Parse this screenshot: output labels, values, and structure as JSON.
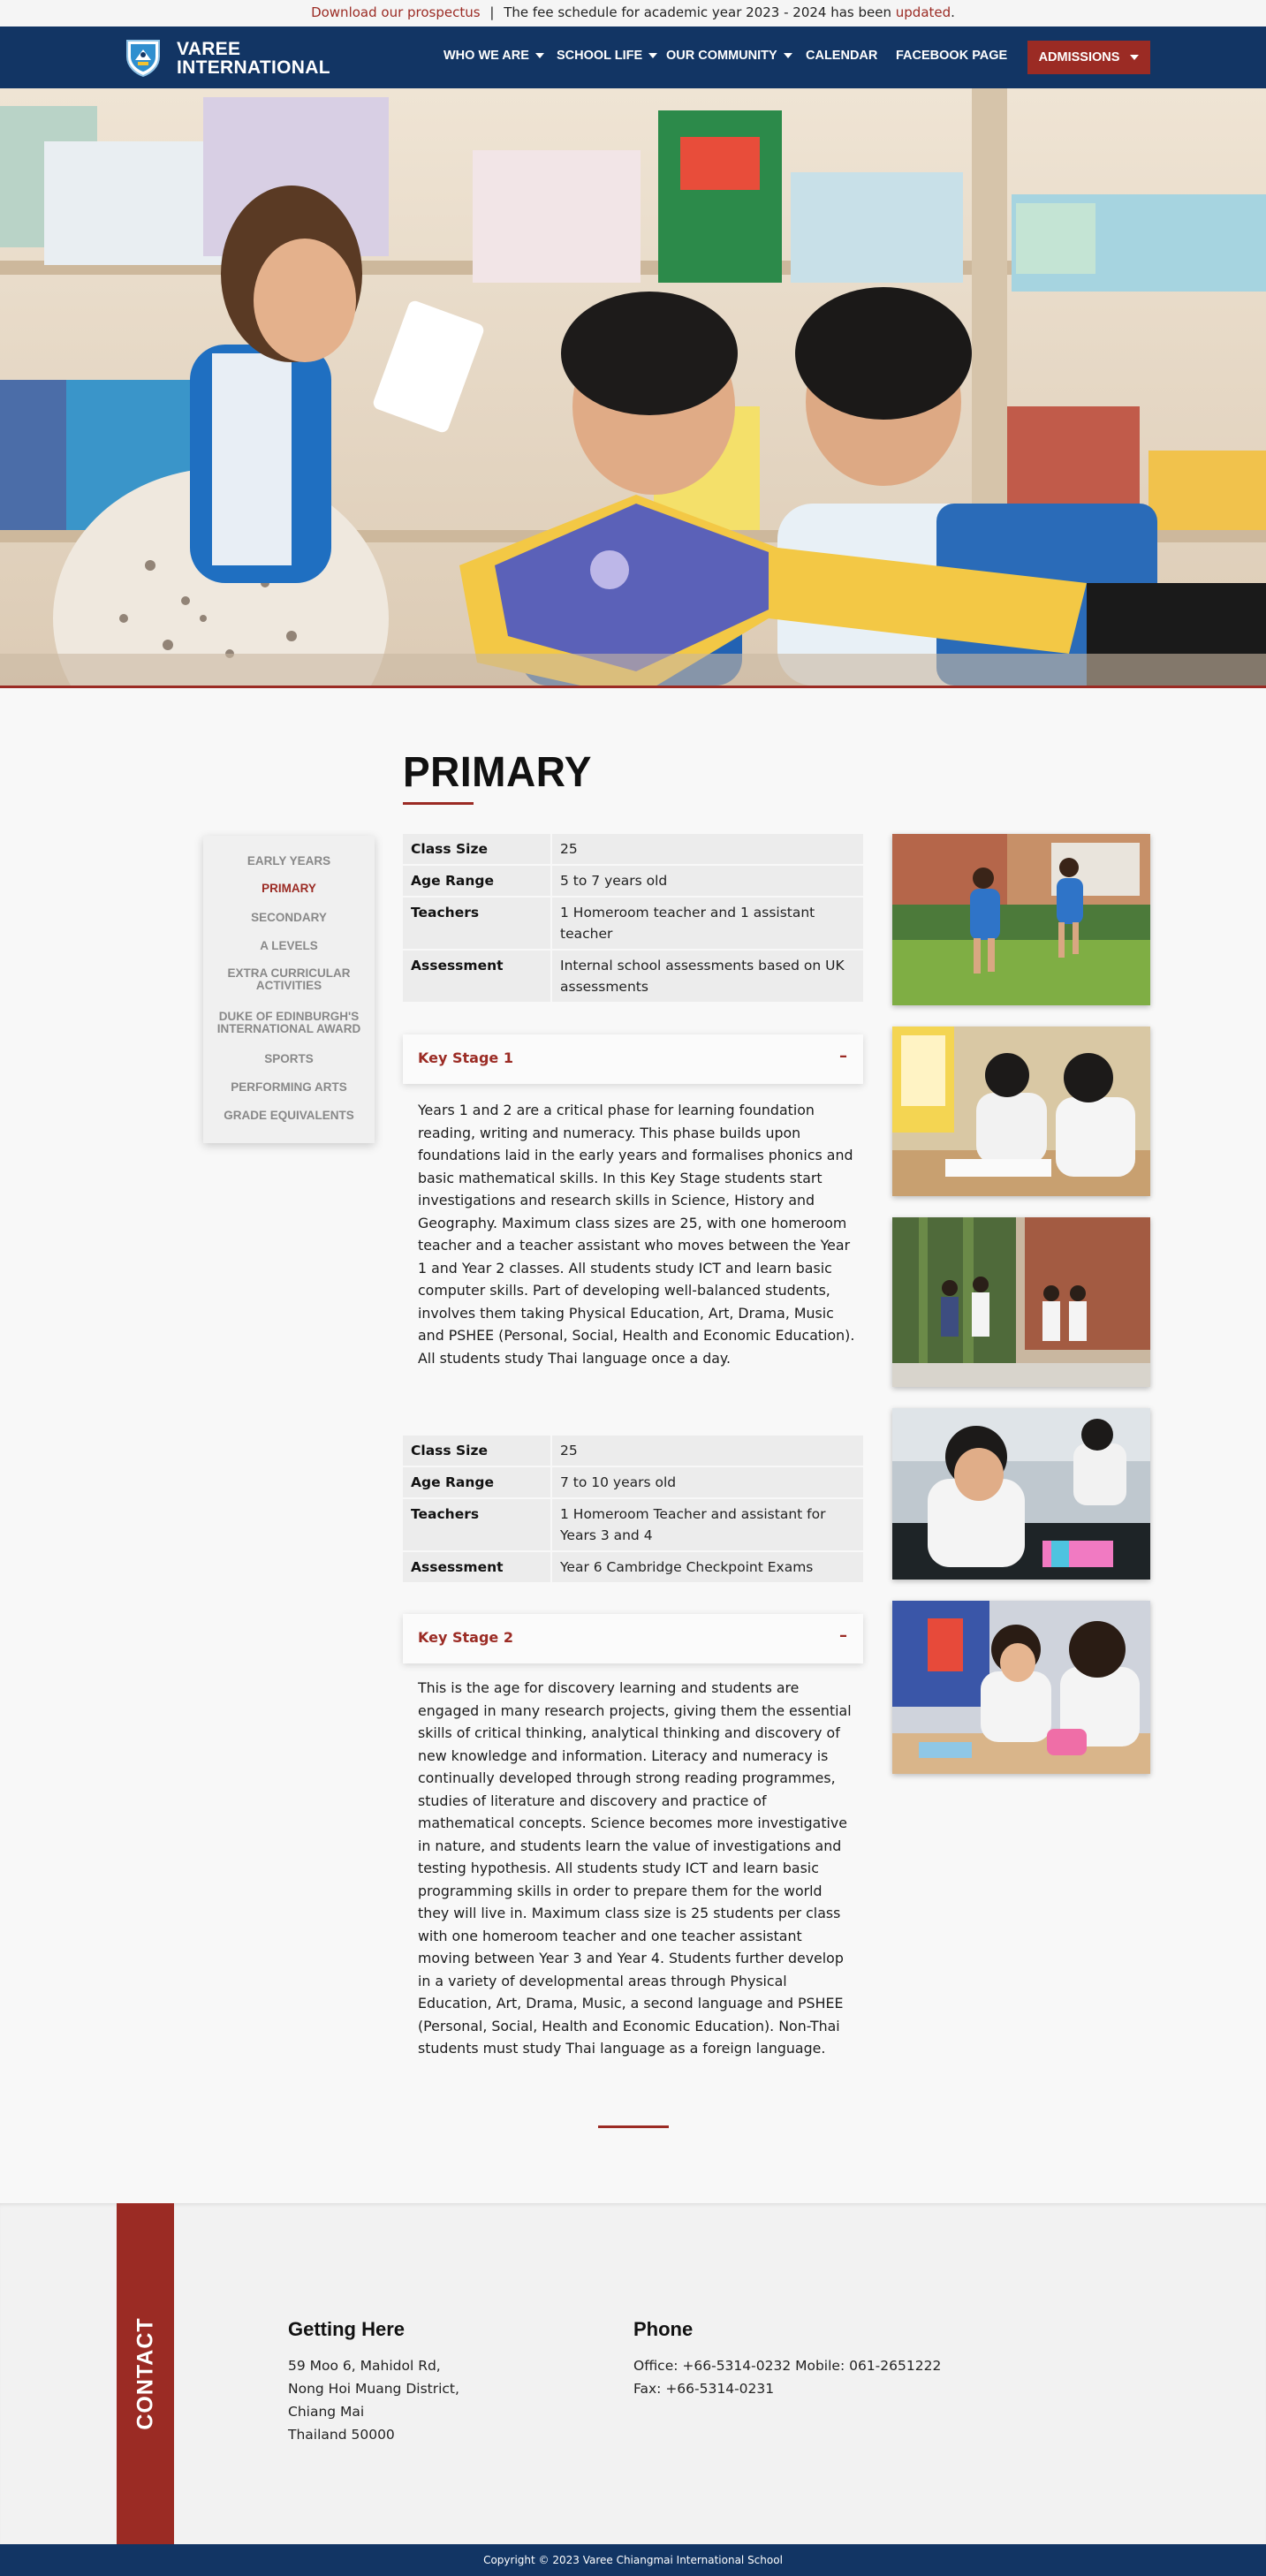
{
  "announcement": {
    "link_text": "Download our prospectus",
    "separator": "|",
    "text": "The fee schedule for academic year 2023 - 2024 has been",
    "link2_text": "updated",
    "suffix": "."
  },
  "header": {
    "logo_line1": "VAREE",
    "logo_line2": "INTERNATIONAL",
    "nav": [
      {
        "label": "WHO WE ARE",
        "has_dropdown": true
      },
      {
        "label": "SCHOOL LIFE",
        "has_dropdown": true
      },
      {
        "label": "OUR COMMUNITY",
        "has_dropdown": true
      },
      {
        "label": "CALENDAR",
        "has_dropdown": false
      },
      {
        "label": "FACEBOOK PAGE",
        "has_dropdown": false
      }
    ],
    "admissions_label": "ADMISSIONS",
    "colors": {
      "navy": "#123564",
      "accent": "#9b2b24"
    }
  },
  "hero": {
    "icon": "hero-photo"
  },
  "page": {
    "title": "PRIMARY"
  },
  "sidebar": {
    "items": [
      {
        "label": "EARLY YEARS",
        "active": false
      },
      {
        "label": "PRIMARY",
        "active": true
      },
      {
        "label": "SECONDARY",
        "active": false
      },
      {
        "label": "A LEVELS",
        "active": false
      },
      {
        "label": "EXTRA CURRICULAR ACTIVITIES",
        "line1": "EXTRA CURRICULAR",
        "line2": "ACTIVITIES",
        "active": false
      },
      {
        "label": "DUKE OF EDINBURGH'S INTERNATIONAL AWARD",
        "line1": "DUKE OF EDINBURGH'S",
        "line2": "INTERNATIONAL AWARD",
        "active": false
      },
      {
        "label": "SPORTS",
        "active": false
      },
      {
        "label": "PERFORMING ARTS",
        "active": false
      },
      {
        "label": "GRADE EQUIVALENTS",
        "active": false
      }
    ]
  },
  "ks1_table": {
    "rows": [
      {
        "key": "Class Size",
        "value": "25"
      },
      {
        "key": "Age Range",
        "value": "5 to 7 years old"
      },
      {
        "key": "Teachers",
        "value": "1 Homeroom teacher and 1 assistant teacher"
      },
      {
        "key": "Assessment",
        "value": "Internal school assessments based on UK assessments"
      }
    ]
  },
  "ks1": {
    "title": "Key Stage 1",
    "toggle": "–",
    "body": "Years 1 and 2 are a critical phase for learning foundation reading, writing and numeracy. This phase builds upon foundations laid in the early years and formalises phonics and basic mathematical skills. In this Key Stage students start investigations and research skills in Science, History and Geography. Maximum class sizes are 25, with one homeroom teacher and a teacher assistant who moves between the Year 1 and Year 2 classes. All students study ICT and learn basic computer skills. Part of developing well-balanced students, involves them taking Physical Education, Art, Drama, Music and PSHEE (Personal, Social, Health and Economic Education). All students study Thai language once a day."
  },
  "ks2_table": {
    "rows": [
      {
        "key": "Class Size",
        "value": "25"
      },
      {
        "key": "Age Range",
        "value": "7 to 10 years old"
      },
      {
        "key": "Teachers",
        "value": "1 Homeroom Teacher and assistant for Years 3 and 4"
      },
      {
        "key": "Assessment",
        "value": "Year 6 Cambridge Checkpoint Exams"
      }
    ]
  },
  "ks2": {
    "title": "Key Stage 2",
    "toggle": "–",
    "body": "This is the age for discovery learning and students are engaged in many research projects, giving them the essential skills of critical thinking, analytical thinking and discovery of new knowledge and information. Literacy and numeracy is continually developed through strong reading programmes, studies of literature and discovery and practice of mathematical concepts. Science becomes more investigative in nature, and students learn the value of investigations and testing hypothesis. All students study ICT and learn basic programming skills in order to prepare them for the world they will live in. Maximum class size is 25 students per class with one homeroom teacher and one teacher assistant moving between Year 3 and Year 4. Students further develop in a variety of developmental areas through Physical Education, Art, Drama, Music, a second language and PSHEE (Personal, Social, Health and Economic Education). Non-Thai students must study Thai language as a foreign language."
  },
  "contact": {
    "label": "CONTACT",
    "getting_here": {
      "heading": "Getting Here",
      "lines": [
        "59 Moo 6, Mahidol Rd,",
        "Nong Hoi Muang District,",
        "Chiang Mai",
        "Thailand 50000"
      ]
    },
    "phone": {
      "heading": "Phone",
      "lines": [
        "Office: +66-5314-0232 Mobile: 061-2651222",
        "Fax: +66-5314-0231"
      ]
    }
  },
  "footer": {
    "copyright": "Copyright © 2023 Varee Chiangmai International School"
  }
}
